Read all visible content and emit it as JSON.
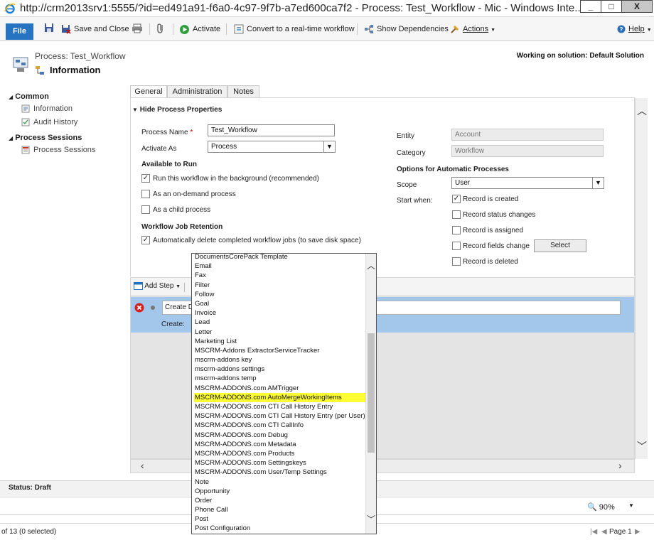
{
  "window": {
    "title": "http://crm2013srv1:5555/?id=ed491a91-f6a0-4c97-9f7b-a7ed600ca7f2 - Process: Test_Workflow - Mic - Windows Inte...",
    "min_glyph": "_",
    "max_glyph": "□",
    "close_glyph": "X"
  },
  "ribbon": {
    "file": "File",
    "save_close": "Save and Close",
    "activate": "Activate",
    "convert": "Convert to a real-time workflow",
    "show_dependencies": "Show Dependencies",
    "actions": "Actions",
    "help": "Help"
  },
  "header": {
    "process_title": "Process: Test_Workflow",
    "section_title": "Information",
    "solution": "Working on solution: Default Solution"
  },
  "nav": {
    "common": "Common",
    "information": "Information",
    "audit_history": "Audit History",
    "process_sessions_header": "Process Sessions",
    "process_sessions": "Process Sessions"
  },
  "tabs": [
    "General",
    "Administration",
    "Notes"
  ],
  "form": {
    "section_toggle": "Hide Process Properties",
    "process_name_label": "Process Name",
    "process_name_value": "Test_Workflow",
    "activate_as_label": "Activate As",
    "activate_as_value": "Process",
    "available_to_run": "Available to Run",
    "run_background": "Run this workflow in the background (recommended)",
    "on_demand": "As an on-demand process",
    "child_process": "As a child process",
    "job_retention": "Workflow Job Retention",
    "auto_delete": "Automatically delete completed workflow jobs (to save disk space)",
    "entity_label": "Entity",
    "entity_value": "Account",
    "category_label": "Category",
    "category_value": "Workflow",
    "options_header": "Options for Automatic Processes",
    "scope_label": "Scope",
    "scope_value": "User",
    "start_when_label": "Start when:",
    "record_created": "Record is created",
    "record_status": "Record status changes",
    "record_assigned": "Record is assigned",
    "record_fields": "Record fields change",
    "select_button": "Select",
    "record_deleted": "Record is deleted"
  },
  "steps": {
    "add_step": "Add Step",
    "step_text": "Create D",
    "create_label": "Create:"
  },
  "status": {
    "text": "Status: Draft",
    "zoom": "90%",
    "records": "of 13 (0 selected)",
    "page": "Page 1"
  },
  "dropdown": {
    "items": [
      "DocumentsCorePack Template",
      "Email",
      "Fax",
      "Filter",
      "Follow",
      "Goal",
      "Invoice",
      "Lead",
      "Letter",
      "Marketing List",
      "MSCRM-Addons ExtractorServiceTracker",
      "mscrm-addons key",
      "mscrm-addons settings",
      "mscrm-addons temp",
      "MSCRM-ADDONS.com AMTrigger",
      "MSCRM-ADDONS.com AutoMergeWorkingItems",
      "MSCRM-ADDONS.com CTI Call History Entry",
      "MSCRM-ADDONS.com CTI Call History Entry (per User)",
      "MSCRM-ADDONS.com CTI CallInfo",
      "MSCRM-ADDONS.com Debug",
      "MSCRM-ADDONS.com Metadata",
      "MSCRM-ADDONS.com Products",
      "MSCRM-ADDONS.com Settingskeys",
      "MSCRM-ADDONS.com User/Temp Settings",
      "Note",
      "Opportunity",
      "Order",
      "Phone Call",
      "Post",
      "Post Configuration"
    ],
    "highlighted_index": 15
  },
  "colors": {
    "file_blue": "#2673c2",
    "highlight": "#ffff33",
    "step_row": "#a3c6eb",
    "required_star": "#d40000"
  }
}
